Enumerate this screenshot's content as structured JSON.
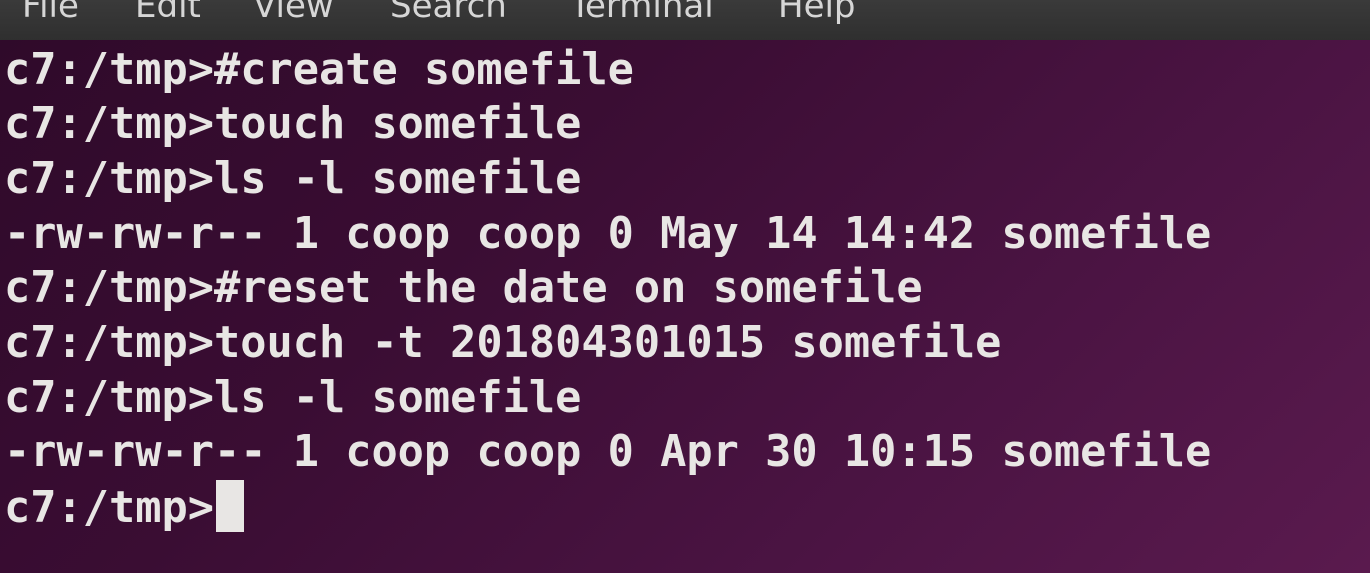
{
  "menubar": {
    "items": [
      "File",
      "Edit",
      "View",
      "Search",
      "Terminal",
      "Help"
    ]
  },
  "terminal": {
    "lines": [
      "c7:/tmp>#create somefile",
      "c7:/tmp>touch somefile",
      "c7:/tmp>ls -l somefile",
      "-rw-rw-r-- 1 coop coop 0 May 14 14:42 somefile",
      "c7:/tmp>#reset the date on somefile",
      "c7:/tmp>touch -t 201804301015 somefile",
      "c7:/tmp>ls -l somefile",
      "-rw-rw-r-- 1 coop coop 0 Apr 30 10:15 somefile"
    ],
    "prompt": "c7:/tmp>"
  },
  "colors": {
    "background": "#3b0d33",
    "text": "#e8e6e4",
    "menubar": "#333333"
  }
}
